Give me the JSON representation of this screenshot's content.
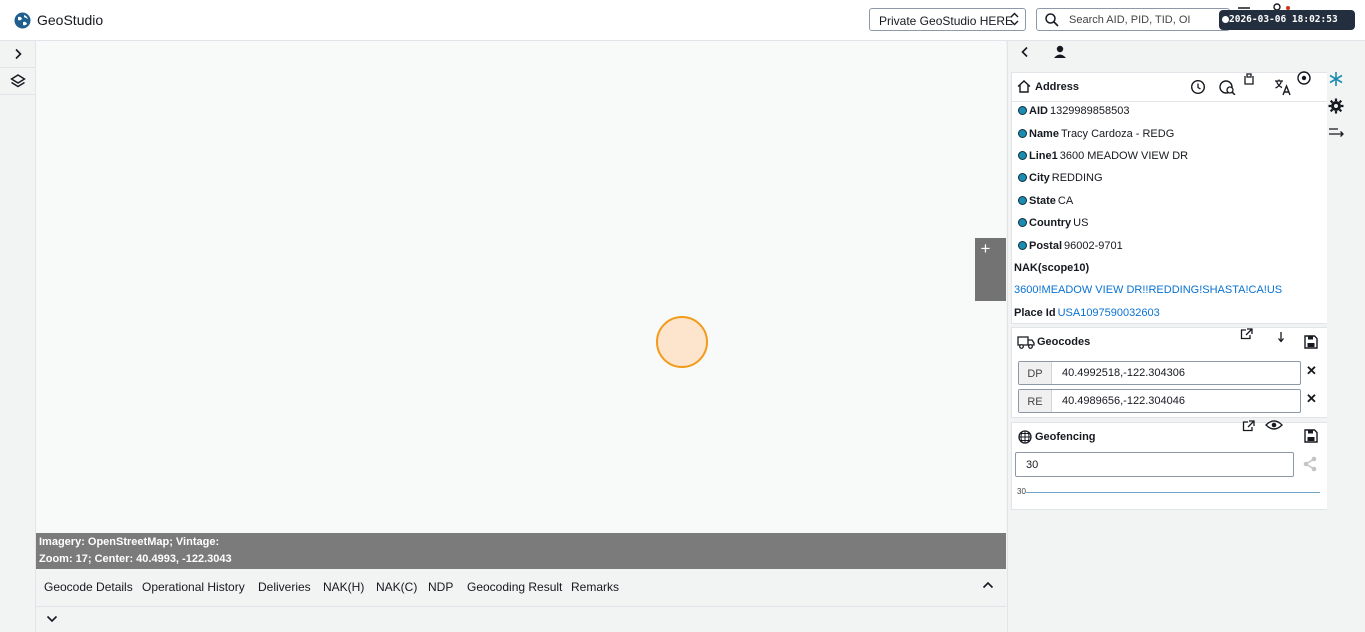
{
  "app": {
    "title": "GeoStudio"
  },
  "header": {
    "env_select": "Private GeoStudio HERE",
    "search_placeholder": "Search AID, PID, TID, OI",
    "timestamp": "2026-03-06 18:02:53"
  },
  "map": {
    "imagery": "Imagery: OpenStreetMap; Vintage:",
    "zoom_center": "Zoom: 17; Center: 40.4993, -122.3043",
    "zoom_in": "+"
  },
  "bottom_tabs": [
    "Geocode Details",
    "Operational History",
    "Deliveries",
    "NAK(H)",
    "NAK(C)",
    "NDP",
    "Geocoding Result",
    "Remarks"
  ],
  "address": {
    "title": "Address",
    "fields": [
      {
        "label": "AID",
        "value": "1329989858503"
      },
      {
        "label": "Name",
        "value": "Tracy Cardoza - REDG"
      },
      {
        "label": "Line1",
        "value": "3600 MEADOW VIEW DR"
      },
      {
        "label": "City",
        "value": "REDDING"
      },
      {
        "label": "State",
        "value": "CA"
      },
      {
        "label": "Country",
        "value": "US"
      },
      {
        "label": "Postal",
        "value": "96002-9701"
      }
    ],
    "nak_label": "NAK(scope10)",
    "nak_value": "3600!MEADOW VIEW DR!!REDDING!SHASTA!CA!US",
    "place_id_label": "Place Id",
    "place_id_value": "USA1097590032603"
  },
  "geocodes": {
    "title": "Geocodes",
    "rows": [
      {
        "tag": "DP",
        "value": "40.4992518,-122.304306"
      },
      {
        "tag": "RE",
        "value": "40.4989656,-122.304046"
      }
    ]
  },
  "geofencing": {
    "title": "Geofencing",
    "radius_value": "30",
    "slider_label": "30"
  },
  "colors": {
    "accent": "#0972d3",
    "marker_fill": "#fde4cc",
    "marker_stroke": "#f29a1a",
    "badge_bg": "#232f3e"
  }
}
